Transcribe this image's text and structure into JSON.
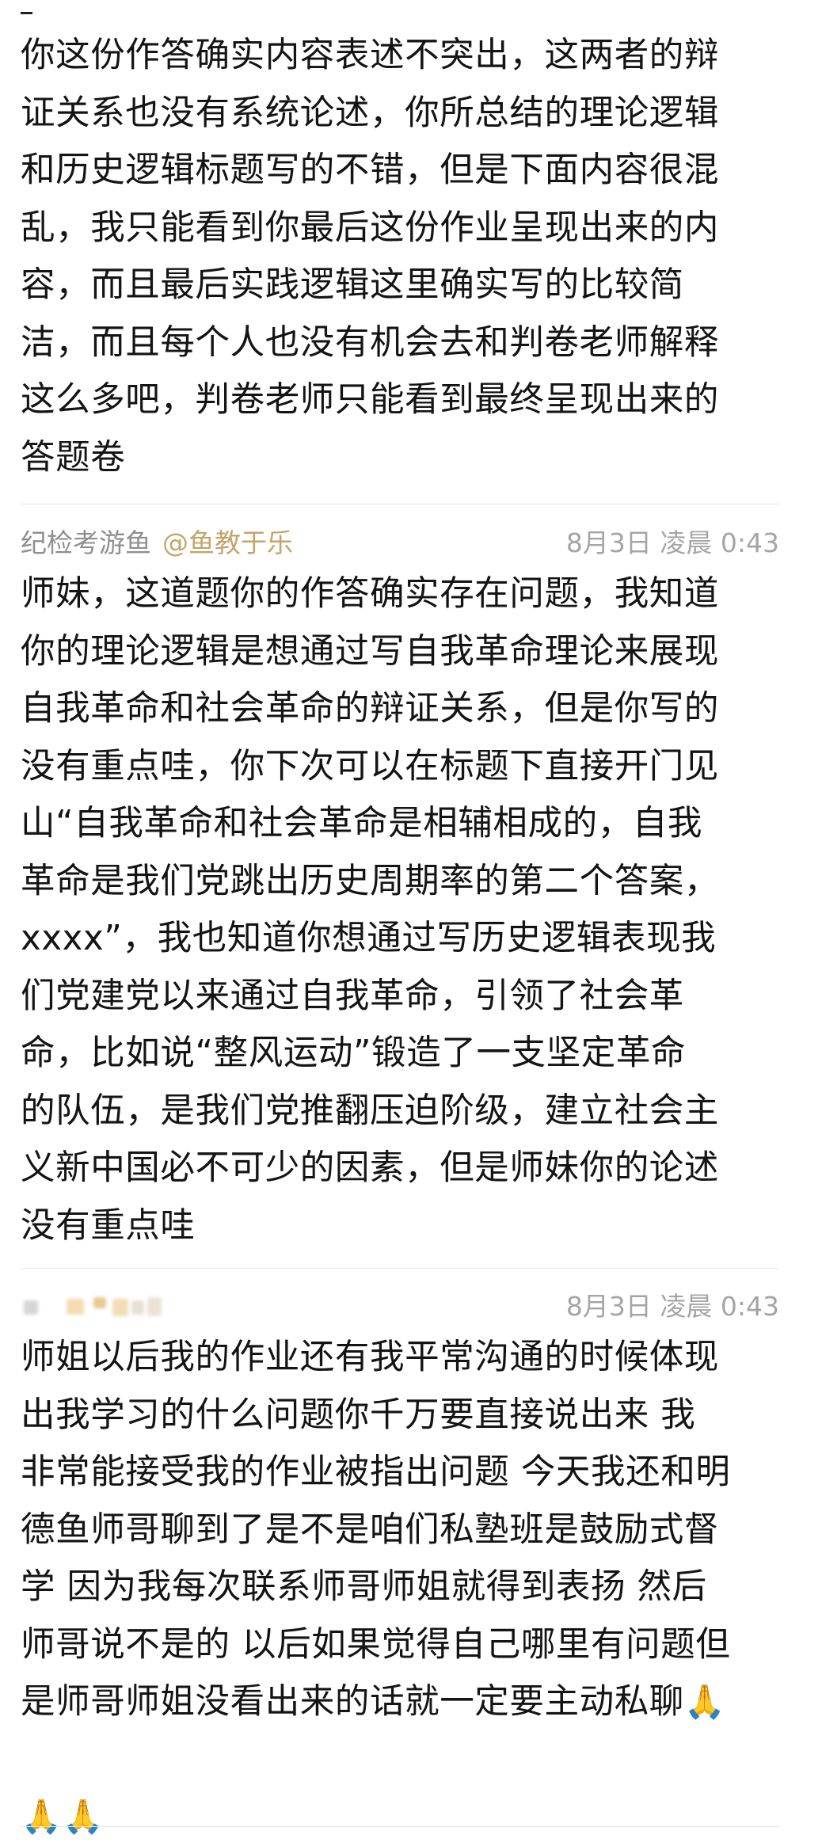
{
  "top_paragraph": "你这份作答确实内容表述不突出，这两者的辩\n证关系也没有系统论述，你所总结的理论逻辑\n和历史逻辑标题写的不错，但是下面内容很混\n乱，我只能看到你最后这份作业呈现出来的内\n容，而且最后实践逻辑这里确实写的比较简\n洁，而且每个人也没有机会去和判卷老师解释\n这么多吧，判卷老师只能看到最终呈现出来的\n答题卷",
  "comment1": {
    "author": "纪检考游鱼",
    "mention": "@鱼教于乐",
    "time": "8月3日 凌晨 0:43",
    "text": "师妹，这道题你的作答确实存在问题，我知道\n你的理论逻辑是想通过写自我革命理论来展现\n自我革命和社会革命的辩证关系，但是你写的\n没有重点哇，你下次可以在标题下直接开门见\n山“自我革命和社会革命是相辅相成的，自我\n革命是我们党跳出历史周期率的第二个答案，\nxxxx”，我也知道你想通过写历史逻辑表现我\n们党建党以来通过自我革命，引领了社会革\n命，比如说“整风运动”锻造了一支坚定革命\n的队伍，是我们党推翻压迫阶级，建立社会主\n义新中国必不可少的因素，但是师妹你的论述\n没有重点哇"
  },
  "comment2": {
    "time": "8月3日 凌晨 0:43",
    "text": "师姐以后我的作业还有我平常沟通的时候体现\n出我学习的什么问题你千万要直接说出来 我\n非常能接受我的作业被指出问题 今天我还和明\n德鱼师哥聊到了是不是咱们私塾班是鼓励式督\n学 因为我每次联系师哥师姐就得到表扬 然后\n师哥说不是的 以后如果觉得自己哪里有问题但\n是师哥师姐没看出来的话就一定要主动私聊",
    "emoji_end_line1": "🙏",
    "emoji_line2": "🙏🙏"
  }
}
